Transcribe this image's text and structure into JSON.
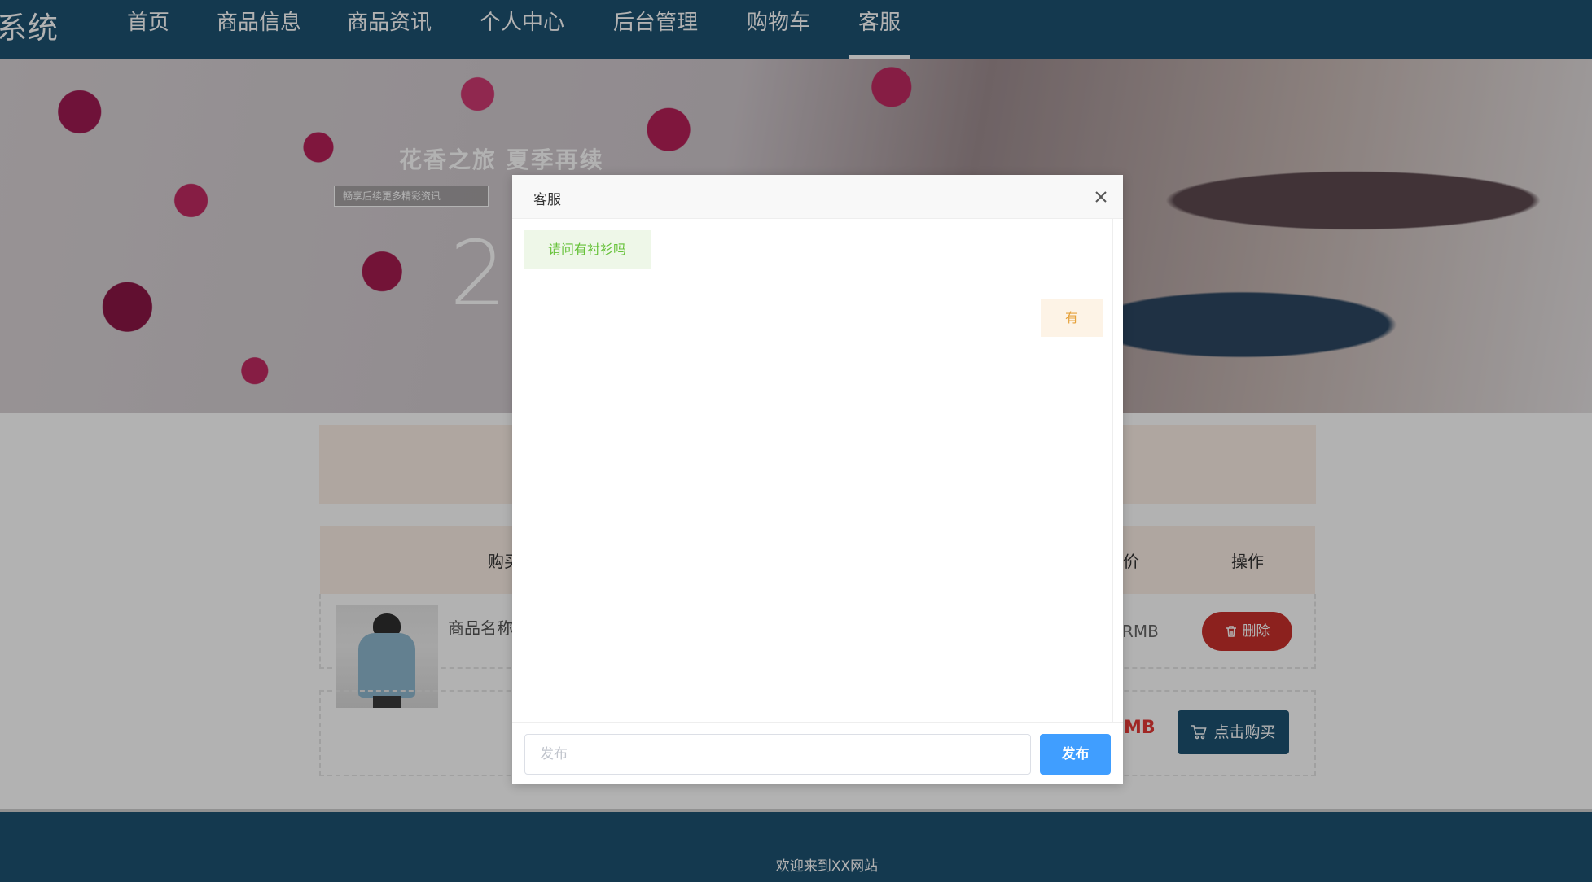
{
  "nav": {
    "brand": "系统",
    "items": [
      {
        "label": "首页"
      },
      {
        "label": "商品信息"
      },
      {
        "label": "商品资讯"
      },
      {
        "label": "个人中心"
      },
      {
        "label": "后台管理"
      },
      {
        "label": "购物车"
      },
      {
        "label": "客服"
      }
    ],
    "active": "客服"
  },
  "banner": {
    "title": "花香之旅 夏季再续",
    "subtitle": "畅享后续更多精彩资讯",
    "number": "2"
  },
  "cart": {
    "columns": [
      "购买",
      "价",
      "操作"
    ],
    "rows": [
      {
        "name": "商品名称",
        "price": "RMB",
        "action": "删除"
      }
    ],
    "total_price": "MB",
    "buy_label": "点击购买"
  },
  "dialog": {
    "title": "客服",
    "messages": [
      {
        "side": "left",
        "text": "请问有衬衫吗"
      },
      {
        "side": "right",
        "text": "有"
      }
    ],
    "input": {
      "placeholder": "发布",
      "value": ""
    },
    "send_label": "发布"
  },
  "footer": {
    "text": "欢迎来到XX网站"
  },
  "colors": {
    "nav_bg": "#1e5272",
    "delete_btn": "#c9302c",
    "send_btn": "#409eff",
    "msg_left": "#67c23a",
    "msg_right": "#e6a23c"
  },
  "icons": [
    "close-icon",
    "trash-icon",
    "cart-icon"
  ]
}
